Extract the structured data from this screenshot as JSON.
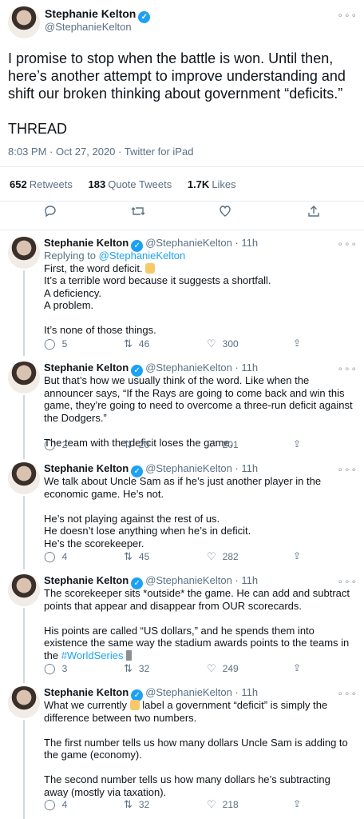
{
  "main": {
    "name": "Stephanie Kelton",
    "handle": "@StephanieKelton",
    "text": "I promise to stop when the battle is won. Until then, here’s another attempt to improve understanding and shift our broken thinking about government “deficits.”\n\nTHREAD",
    "meta": "8:03 PM · Oct 27, 2020 · Twitter for iPad",
    "retweets": "652",
    "retweets_label": "Retweets",
    "quotes": "183",
    "quotes_label": "Quote Tweets",
    "likes": "1.7K",
    "likes_label": "Likes"
  },
  "replies": [
    {
      "name": "Stephanie Kelton",
      "handle": "@StephanieKelton · 11h",
      "replying_prefix": "Replying to ",
      "replying_to": "@StephanieKelton",
      "text_a": "First, the word deficit. ",
      "text_b": "\nIt’s a terrible word because it suggests a shortfall.\nA deficiency.\nA problem.\n\nIt’s none of those things.",
      "replies": "5",
      "retweets": "46",
      "likes": "300"
    },
    {
      "name": "Stephanie Kelton",
      "handle": "@StephanieKelton · 11h",
      "text": "But that’s how we usually think of the word. Like when the announcer says, “If the Rays are going to come back and win this game, they’re going to need to overcome a three-run deficit against the Dodgers.”\n\nThe team with the deficit loses the game.",
      "replies": "2",
      "retweets": "20",
      "likes": "201"
    },
    {
      "name": "Stephanie Kelton",
      "handle": "@StephanieKelton · 11h",
      "text": "We talk about Uncle Sam as if he’s just another player in the economic game. He’s not.\n\nHe’s not playing against the rest of us.\nHe doesn’t lose anything when he’s in deficit.\nHe’s the scorekeeper.",
      "replies": "4",
      "retweets": "45",
      "likes": "282"
    },
    {
      "name": "Stephanie Kelton",
      "handle": "@StephanieKelton · 11h",
      "text_a": "The scorekeeper sits *outside* the game. He can add and subtract points that appear and disappear from OUR scorecards.\n\nHis points are called “US dollars,” and he spends them into existence the same way the stadium awards points to the teams in the ",
      "hashtag": "#WorldSeries",
      "replies": "3",
      "retweets": "32",
      "likes": "249"
    },
    {
      "name": "Stephanie Kelton",
      "handle": "@StephanieKelton · 11h",
      "text_a": "What we currently ",
      "text_b": " label a government “deficit” is simply the difference between two numbers.\n\nThe first number tells us how many dollars Uncle Sam is adding to the game (economy).\n\nThe second number tells us how many dollars he’s subtracting away (mostly via taxation).",
      "replies": "4",
      "retweets": "32",
      "likes": "218"
    }
  ],
  "icons": {
    "reply": "reply-icon",
    "retweet": "retweet-icon",
    "like": "heart-icon",
    "share": "share-icon",
    "more": "more-icon",
    "verified": "verified-badge-icon"
  },
  "colors": {
    "link": "#1da1f2",
    "muted": "#5b7083"
  }
}
